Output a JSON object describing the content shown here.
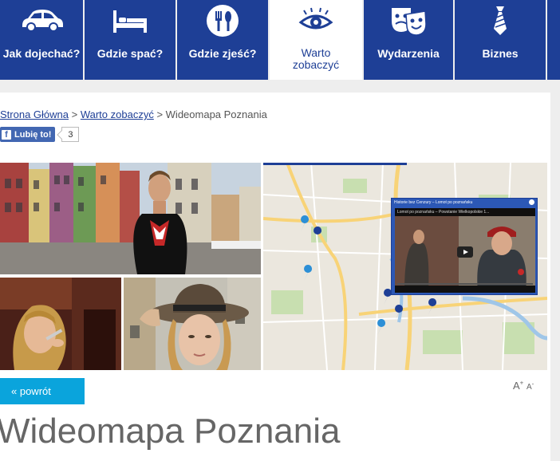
{
  "nav": {
    "items": [
      {
        "label": "Jak dojechać?",
        "icon": "car-icon",
        "active": false
      },
      {
        "label": "Gdzie spać?",
        "icon": "bed-icon",
        "active": false
      },
      {
        "label": "Gdzie zjeść?",
        "icon": "fork-knife-icon",
        "active": false
      },
      {
        "label": "Warto zobaczyć",
        "icon": "eye-icon",
        "active": true
      },
      {
        "label": "Wydarzenia",
        "icon": "theater-masks-icon",
        "active": false
      },
      {
        "label": "Biznes",
        "icon": "tie-icon",
        "active": false
      }
    ]
  },
  "breadcrumb": {
    "home": "Strona Główna",
    "sep1": " > ",
    "section": "Warto zobaczyć",
    "sep2": " > ",
    "current": "Wideomapa Poznania"
  },
  "facebook": {
    "icon": "facebook-f-icon",
    "like_label": "Lubię to!",
    "count": "3"
  },
  "video": {
    "header": "Historie bez Cenzury – Lomot po poznańsku",
    "title": "Lomot po poznańsku – Powstanie Wielkopolskie 1..."
  },
  "back_button": "« powrót",
  "font_size": {
    "large": "A",
    "large_sup": "+",
    "small": "A",
    "small_sup": "-"
  },
  "page_title": "Wideomapa Poznania",
  "colors": {
    "nav_bg": "#1e3f96",
    "nav_active_bg": "#ffffff",
    "back_button_bg": "#0aa4dc",
    "link": "#1e3f96"
  }
}
